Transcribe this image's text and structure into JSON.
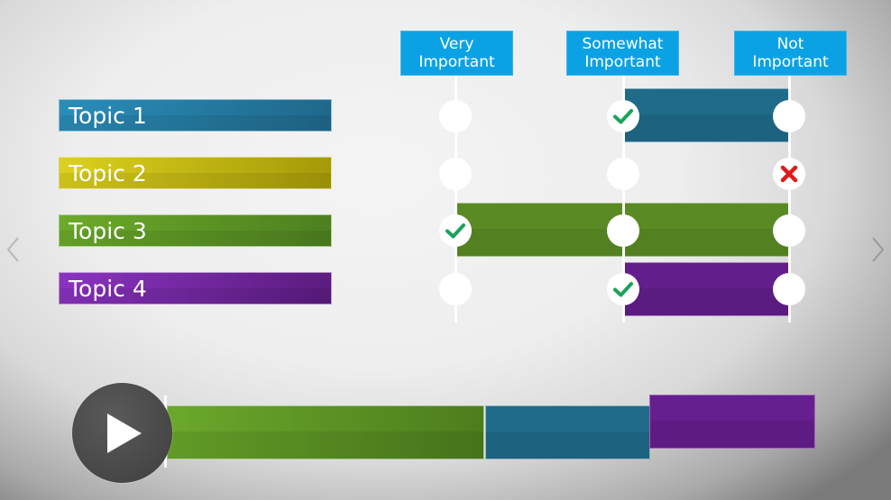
{
  "columns": [
    {
      "line1": "Very",
      "line2": "Important"
    },
    {
      "line1": "Somewhat",
      "line2": "Important"
    },
    {
      "line1": "Not",
      "line2": "Important"
    }
  ],
  "topics": [
    {
      "label": "Topic 1",
      "color": "#2a8db9",
      "marks": [
        "empty",
        "check",
        "empty"
      ],
      "range": [
        "Somewhat Important",
        "Not Important"
      ]
    },
    {
      "label": "Topic 2",
      "color": "#c9bd12",
      "marks": [
        "empty",
        "empty",
        "cross"
      ],
      "range": null
    },
    {
      "label": "Topic 3",
      "color": "#62982a",
      "marks": [
        "check",
        "empty",
        "empty"
      ],
      "range": [
        "Very Important",
        "Not Important"
      ]
    },
    {
      "label": "Topic 4",
      "color": "#7528a6",
      "marks": [
        "empty",
        "check",
        "empty"
      ],
      "range": [
        "Somewhat Important",
        "Not Important"
      ]
    }
  ],
  "icons": {
    "check": "check-icon",
    "cross": "cross-icon",
    "prev": "chevron-left-icon",
    "next": "chevron-right-icon",
    "play": "play-icon"
  },
  "colors": {
    "header": "#0aa2e4",
    "check": "#1aa35a",
    "cross": "#e01b1b"
  },
  "player": {
    "segments": [
      {
        "name": "green",
        "color": "#5a8a23"
      },
      {
        "name": "blue",
        "color": "#206b89"
      },
      {
        "name": "purple",
        "color": "#661f8f"
      }
    ]
  }
}
